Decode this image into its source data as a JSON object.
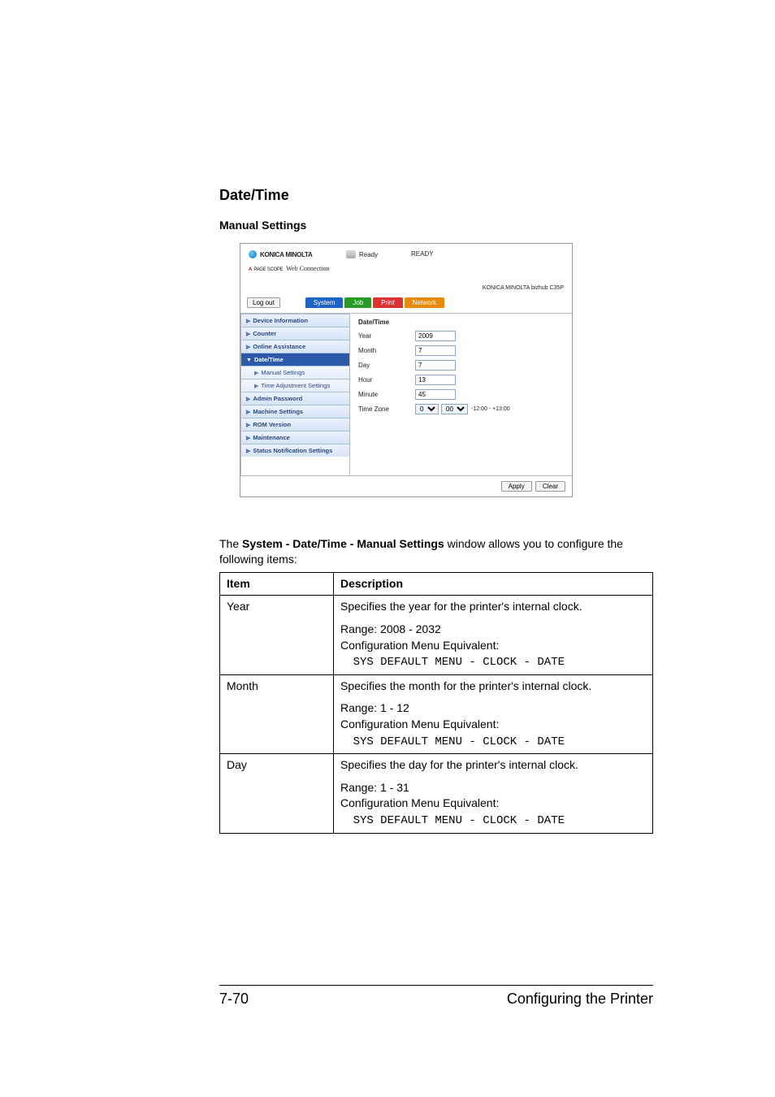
{
  "section": {
    "title": "Date/Time",
    "subtitle": "Manual Settings"
  },
  "shot": {
    "brand": "KONICA MINOLTA",
    "webconn_prefix": "PAGE SCOPE",
    "webconn": "Web Connection",
    "status_label": "Ready",
    "status_text": "READY",
    "model": "KONICA MINOLTA bizhub C35P",
    "logout": "Log out",
    "tabs": {
      "system": "System",
      "job": "Job",
      "print": "Print",
      "network": "Network"
    },
    "sidebar": {
      "device_info": "Device Information",
      "counter": "Counter",
      "online_assist": "Online Assistance",
      "date_time": "Date/Time",
      "manual_settings": "Manual Settings",
      "time_adj": "Time Adjustment Settings",
      "admin_pw": "Admin Password",
      "machine_set": "Machine Settings",
      "rom_ver": "ROM Version",
      "maintenance": "Maintenance",
      "status_notif": "Status Notification Settings"
    },
    "form": {
      "heading": "Date/Time",
      "year_label": "Year",
      "year_val": "2009",
      "month_label": "Month",
      "month_val": "7",
      "day_label": "Day",
      "day_val": "7",
      "hour_label": "Hour",
      "hour_val": "13",
      "minute_label": "Minute",
      "minute_val": "45",
      "tz_label": "Time Zone",
      "tz_h": "0",
      "tz_m": "00",
      "tz_range": "-12:00 - +13:00",
      "apply": "Apply",
      "clear": "Clear"
    }
  },
  "paragraph": {
    "pre": "The ",
    "bold": "System - Date/Time - Manual Settings",
    "post": " window allows you to configure the following items:"
  },
  "table": {
    "h_item": "Item",
    "h_desc": "Description",
    "rows": [
      {
        "item": "Year",
        "d1": "Specifies the year for the printer's internal clock.",
        "d2a": "Range: 2008 - 2032",
        "d2b": "Configuration Menu Equivalent:",
        "d2c": "SYS DEFAULT MENU - CLOCK - DATE"
      },
      {
        "item": "Month",
        "d1": "Specifies the month for the printer's internal clock.",
        "d2a": "Range: 1 - 12",
        "d2b": "Configuration Menu Equivalent:",
        "d2c": "SYS DEFAULT MENU - CLOCK - DATE"
      },
      {
        "item": "Day",
        "d1": "Specifies the day for the printer's internal clock.",
        "d2a": "Range: 1 - 31",
        "d2b": "Configuration Menu Equivalent:",
        "d2c": "SYS DEFAULT MENU - CLOCK - DATE"
      }
    ]
  },
  "footer": {
    "page": "7-70",
    "label": "Configuring the Printer"
  }
}
